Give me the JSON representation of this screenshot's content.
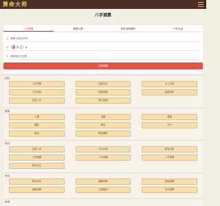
{
  "header": {
    "logo": "算命大师",
    "menu_icon": "menu-icon"
  },
  "page_title": "八字测算",
  "tabs": [
    {
      "label": "八字测算",
      "active": true
    },
    {
      "label": "紫微斗数",
      "active": false
    },
    {
      "label": "老年运势解析",
      "active": false
    },
    {
      "label": "十年大运",
      "active": false
    }
  ],
  "form": {
    "name_label": "名",
    "name_placeholder": "请输入姓名(可不)",
    "gender_label": "别",
    "gender_options": [
      "男",
      "女"
    ],
    "gender_selected": "男",
    "birth_label": "生",
    "birth_placeholder": "请选择出生日期",
    "submit_label": "立即测算"
  },
  "sections": [
    {
      "title": "四柱",
      "items": [
        "八字详情",
        "四柱五行",
        "占卜问卦",
        "八字分析",
        "四柱排盘",
        "运势流年",
        "生辰八字",
        "财门运势"
      ]
    },
    {
      "title": "星座",
      "items": [
        "人格",
        "运程",
        "星座",
        "婚配",
        "事业",
        "五行",
        "财运",
        "职位解析"
      ]
    },
    {
      "title": "测试",
      "items": [
        "生辰八字",
        "五行分析",
        "姓名分析",
        "三世因果",
        "八字合婚",
        "八字测算",
        "前世今生"
      ]
    },
    {
      "title": "综合",
      "items": [
        "事业分析",
        "姻缘测算",
        "综合测算",
        "运程测算",
        "生辰配对",
        "五行测算"
      ]
    },
    {
      "title": "其他",
      "items": []
    }
  ]
}
